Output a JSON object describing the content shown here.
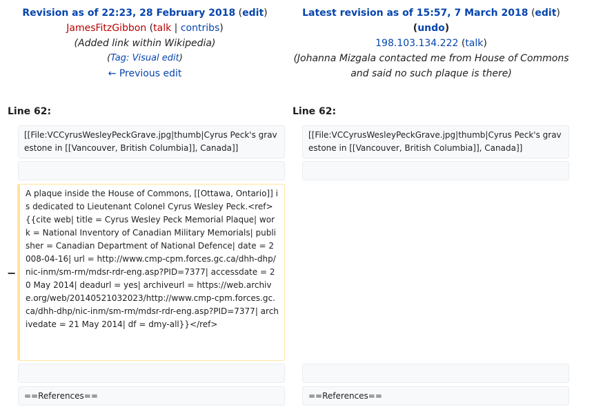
{
  "left_header": {
    "title": "Revision as of 22:23, 28 February 2018",
    "edit_link": "edit",
    "user": "JamesFitzGibbon",
    "talk": "talk",
    "separator": "|",
    "contribs": "contribs",
    "summary": "(Added link within Wikipedia)",
    "tag_prefix": "(",
    "tag_label": "Tag:",
    "tag_name": "Visual edit",
    "tag_suffix": ")",
    "previous_edit": "← Previous edit"
  },
  "right_header": {
    "title": "Latest revision as of 15:57, 7 March 2018",
    "edit_link": "edit",
    "undo_link": "undo",
    "ip": "198.103.134.222",
    "talk": "talk",
    "summary_line1": "(Johanna Mizgala contacted me from House of Commons",
    "summary_line2": "and said no such plaque is there)"
  },
  "line_label": "Line 62:",
  "diff": {
    "left_context1": "[[File:VCCyrusWesleyPeckGrave.jpg|thumb|Cyrus Peck's gravestone in [[Vancouver, British Columbia]], Canada]]",
    "right_context1": "[[File:VCCyrusWesleyPeckGrave.jpg|thumb|Cyrus Peck's gravestone in [[Vancouver, British Columbia]], Canada]]",
    "minus_marker": "−",
    "deleted_text": "A plaque inside the House of Commons, [[Ottawa, Ontario]] is dedicated to Lieutenant Colonel Cyrus Wesley Peck.<ref>{{cite web| title = Cyrus Wesley Peck Memorial Plaque| work = National Inventory of Canadian Military Memorials| publisher = Canadian Department of National Defence| date = 2008-04-16| url = http://www.cmp-cpm.forces.gc.ca/dhh-dhp/nic-inm/sm-rm/mdsr-rdr-eng.asp?PID=7377| accessdate = 20 May 2014| deadurl = yes| archiveurl = https://web.archive.org/web/20140521032023/http://www.cmp-cpm.forces.gc.ca/dhh-dhp/nic-inm/sm-rm/mdsr-rdr-eng.asp?PID=7377| archivedate = 21 May 2014| df = dmy-all}}</ref>",
    "left_references": "==References==",
    "right_references": "==References=="
  }
}
